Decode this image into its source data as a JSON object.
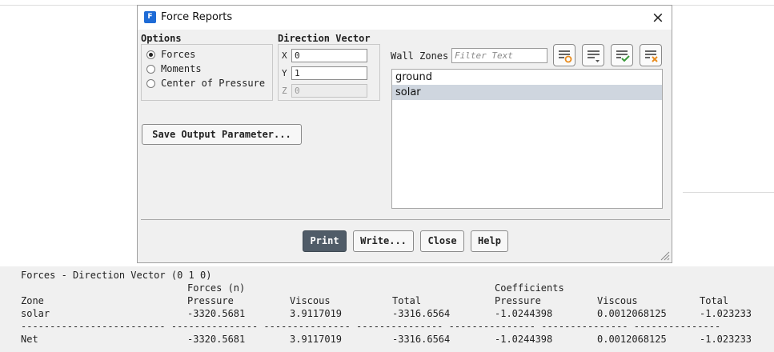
{
  "window": {
    "app_icon_letter": "F",
    "title": "Force Reports",
    "close_glyph": "×"
  },
  "options": {
    "label": "Options",
    "items": [
      {
        "label": "Forces",
        "selected": true
      },
      {
        "label": "Moments",
        "selected": false
      },
      {
        "label": "Center of Pressure",
        "selected": false
      }
    ]
  },
  "direction_vector": {
    "label": "Direction Vector",
    "x": {
      "label": "X",
      "value": "0",
      "enabled": true
    },
    "y": {
      "label": "Y",
      "value": "1",
      "enabled": true
    },
    "z": {
      "label": "Z",
      "value": "0",
      "enabled": false
    }
  },
  "save_output_parameter": "Save Output Parameter...",
  "wall_zones": {
    "label": "Wall Zones",
    "filter_placeholder": "Filter Text",
    "toolbar_icons": [
      "select-all-icon",
      "deselect-all-icon",
      "apply-selection-icon",
      "clear-selection-icon"
    ],
    "items": [
      {
        "label": "ground",
        "selected": false
      },
      {
        "label": "solar",
        "selected": true
      }
    ]
  },
  "buttons": {
    "print": "Print",
    "write": "Write...",
    "close": "Close",
    "help": "Help"
  },
  "console": {
    "title": "Forces - Direction Vector (0 1 0)",
    "group_forces": "Forces (n)",
    "group_coefficients": "Coefficients",
    "headers": [
      "Zone",
      "Pressure",
      "Viscous",
      "Total",
      "Pressure",
      "Viscous",
      "Total"
    ],
    "rows": [
      {
        "zone": "solar",
        "values": [
          "-3320.5681",
          "3.9117019",
          "-3316.6564",
          "-1.0244398",
          "0.0012068125",
          "-1.023233"
        ]
      }
    ],
    "separator": "------------------------- --------------- --------------- --------------- --------------- --------------- ---------------",
    "net": {
      "zone": "Net",
      "values": [
        "-3320.5681",
        "3.9117019",
        "-3316.6564",
        "-1.0244398",
        "0.0012068125",
        "-1.023233"
      ]
    }
  },
  "colors": {
    "accent": "#1e6bd6",
    "primary_button": "#505c68",
    "selection": "#cfd6df",
    "icon_orange": "#e98b1c",
    "icon_green": "#3a9a3a"
  }
}
